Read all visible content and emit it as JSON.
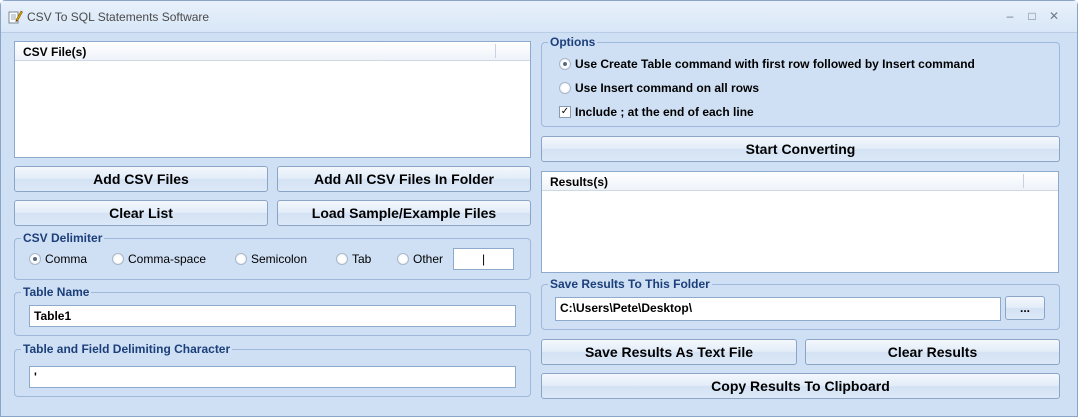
{
  "window": {
    "title": "CSV To SQL Statements Software",
    "minimize": "–",
    "maximize": "□",
    "close": "✕"
  },
  "csv_files": {
    "header": "CSV File(s)",
    "add_button": "Add CSV Files",
    "add_folder_button": "Add All CSV Files In Folder",
    "clear_button": "Clear List",
    "load_sample_button": "Load Sample/Example Files"
  },
  "delimiter": {
    "legend": "CSV Delimiter",
    "options": [
      "Comma",
      "Comma-space",
      "Semicolon",
      "Tab",
      "Other"
    ],
    "selected": "Comma",
    "other_value": "|"
  },
  "table_name": {
    "legend": "Table Name",
    "value": "Table1"
  },
  "field_delim": {
    "legend": "Table and Field Delimiting Character",
    "value": "'"
  },
  "options": {
    "legend": "Options",
    "opt1": "Use Create Table command with first row followed by Insert command",
    "opt2": "Use Insert command on all rows",
    "opt3": "Include ; at the end of each line",
    "opt1_selected": true,
    "opt3_checked": true
  },
  "start_button": "Start Converting",
  "results": {
    "header": "Results(s)"
  },
  "save_folder": {
    "legend": "Save Results To This Folder",
    "path": "C:\\Users\\Pete\\Desktop\\",
    "browse": "..."
  },
  "save_text_button": "Save Results As Text File",
  "clear_results_button": "Clear Results",
  "copy_button": "Copy Results To Clipboard",
  "icons": {
    "app": "pencil-document-icon"
  },
  "colors": {
    "background": "#cfe0f5",
    "legend_text": "#1c3f7a",
    "border": "#8ba5c7"
  }
}
